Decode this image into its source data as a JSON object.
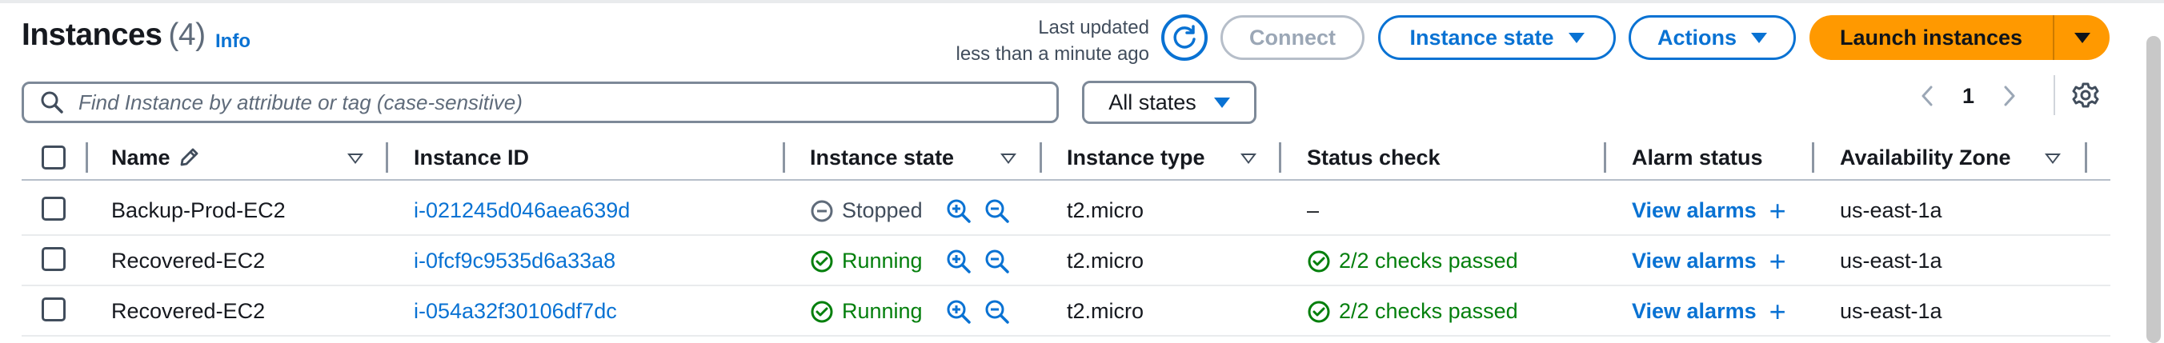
{
  "header": {
    "title": "Instances",
    "count": "(4)",
    "info_link": "Info",
    "last_updated_line1": "Last updated",
    "last_updated_line2": "less than a minute ago",
    "refresh_icon": "refresh-icon",
    "connect_label": "Connect",
    "instance_state_label": "Instance state",
    "actions_label": "Actions",
    "launch_label": "Launch instances"
  },
  "filter": {
    "search_placeholder": "Find Instance by attribute or tag (case-sensitive)",
    "states_label": "All states"
  },
  "pagination": {
    "current_page": "1"
  },
  "table": {
    "columns": [
      "Name",
      "Instance ID",
      "Instance state",
      "Instance type",
      "Status check",
      "Alarm status",
      "Availability Zone"
    ],
    "rows": [
      {
        "name": "Backup-Prod-EC2",
        "instance_id": "i-021245d046aea639d",
        "state": "Stopped",
        "state_kind": "stopped",
        "type": "t2.micro",
        "status_check": "–",
        "alarm": "View alarms",
        "zone": "us-east-1a"
      },
      {
        "name": "Recovered-EC2",
        "instance_id": "i-0fcf9c9535d6a33a8",
        "state": "Running",
        "state_kind": "running",
        "type": "t2.micro",
        "status_check": "2/2 checks passed",
        "alarm": "View alarms",
        "zone": "us-east-1a"
      },
      {
        "name": "Recovered-EC2",
        "instance_id": "i-054a32f30106df7dc",
        "state": "Running",
        "state_kind": "running",
        "type": "t2.micro",
        "status_check": "2/2 checks passed",
        "alarm": "View alarms",
        "zone": "us-east-1a"
      }
    ]
  },
  "colors": {
    "accent": "#0972d3",
    "launch": "#ff9900",
    "success": "#037f0c",
    "text": "#16191f",
    "secondary": "#414d5c"
  }
}
